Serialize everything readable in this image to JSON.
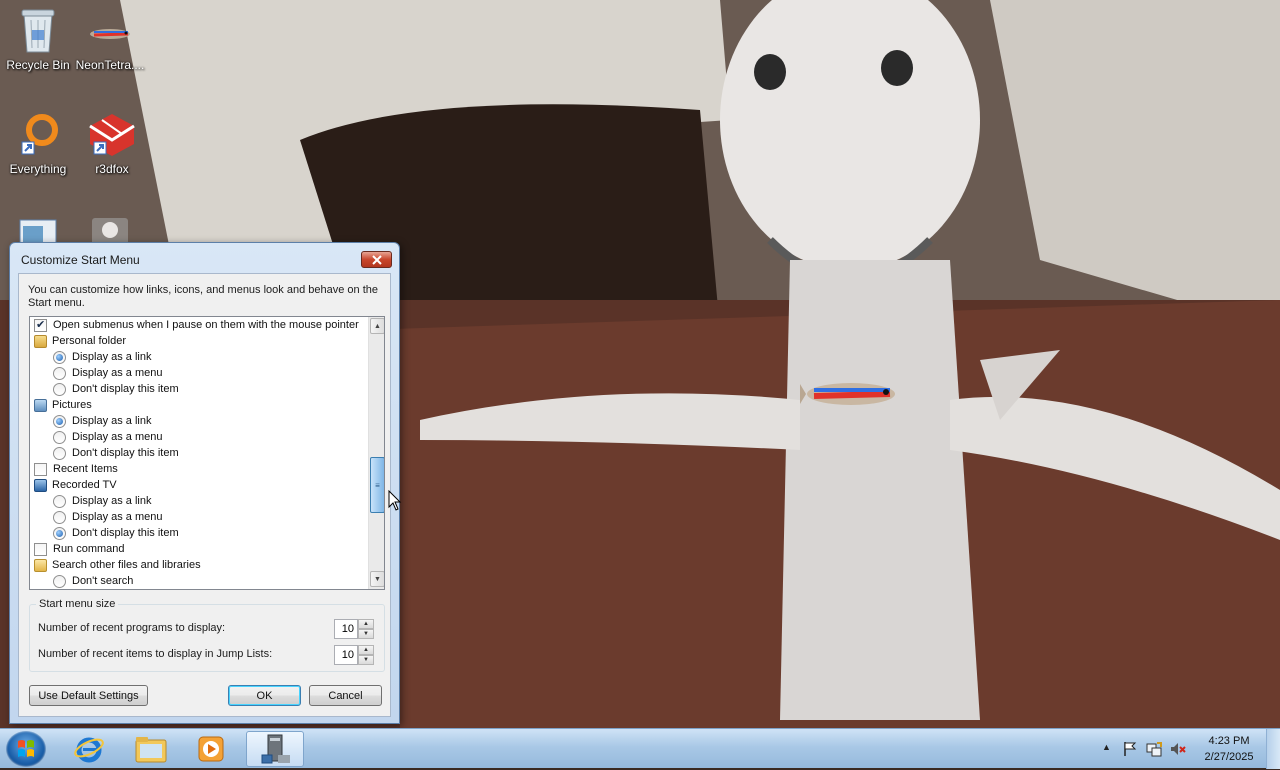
{
  "desktop": {
    "icons": [
      {
        "label": "Recycle Bin",
        "icon": "recycle-bin-icon"
      },
      {
        "label": "NeonTetra....",
        "icon": "neon-tetra-fish-icon"
      },
      {
        "label": "Everything",
        "icon": "everything-search-icon"
      },
      {
        "label": "r3dfox",
        "icon": "r3dfox-browser-icon"
      }
    ]
  },
  "dialog": {
    "title": "Customize Start Menu",
    "intro": "You can customize how links, icons, and menus look and behave on the Start menu.",
    "options": [
      {
        "type": "checkbox",
        "checked": true,
        "label": "Open submenus when I pause on them with the mouse pointer"
      },
      {
        "type": "category",
        "label": "Personal folder",
        "icon": "personal-folder-icon"
      },
      {
        "type": "radio",
        "checked": true,
        "label": "Display as a link"
      },
      {
        "type": "radio",
        "checked": false,
        "label": "Display as a menu"
      },
      {
        "type": "radio",
        "checked": false,
        "label": "Don't display this item"
      },
      {
        "type": "category",
        "label": "Pictures",
        "icon": "pictures-icon"
      },
      {
        "type": "radio",
        "checked": true,
        "label": "Display as a link"
      },
      {
        "type": "radio",
        "checked": false,
        "label": "Display as a menu"
      },
      {
        "type": "radio",
        "checked": false,
        "label": "Don't display this item"
      },
      {
        "type": "checkbox",
        "checked": false,
        "label": "Recent Items"
      },
      {
        "type": "category",
        "label": "Recorded TV",
        "icon": "recorded-tv-icon"
      },
      {
        "type": "radio",
        "checked": false,
        "label": "Display as a link"
      },
      {
        "type": "radio",
        "checked": false,
        "label": "Display as a menu"
      },
      {
        "type": "radio",
        "checked": true,
        "label": "Don't display this item"
      },
      {
        "type": "checkbox",
        "checked": false,
        "label": "Run command"
      },
      {
        "type": "category",
        "label": "Search other files and libraries",
        "icon": "search-files-icon"
      },
      {
        "type": "radio",
        "checked": false,
        "label": "Don't search"
      }
    ],
    "size_group": {
      "legend": "Start menu size",
      "recent_programs_label": "Number of recent programs to display:",
      "recent_programs_value": "10",
      "jump_list_label": "Number of recent items to display in Jump Lists:",
      "jump_list_value": "10"
    },
    "buttons": {
      "defaults": "Use Default Settings",
      "ok": "OK",
      "cancel": "Cancel"
    }
  },
  "taskbar": {
    "pinned": [
      "internet-explorer-icon",
      "windows-explorer-icon",
      "media-player-icon",
      "control-panel-icon"
    ],
    "clock_time": "4:23 PM",
    "clock_date": "2/27/2025"
  }
}
